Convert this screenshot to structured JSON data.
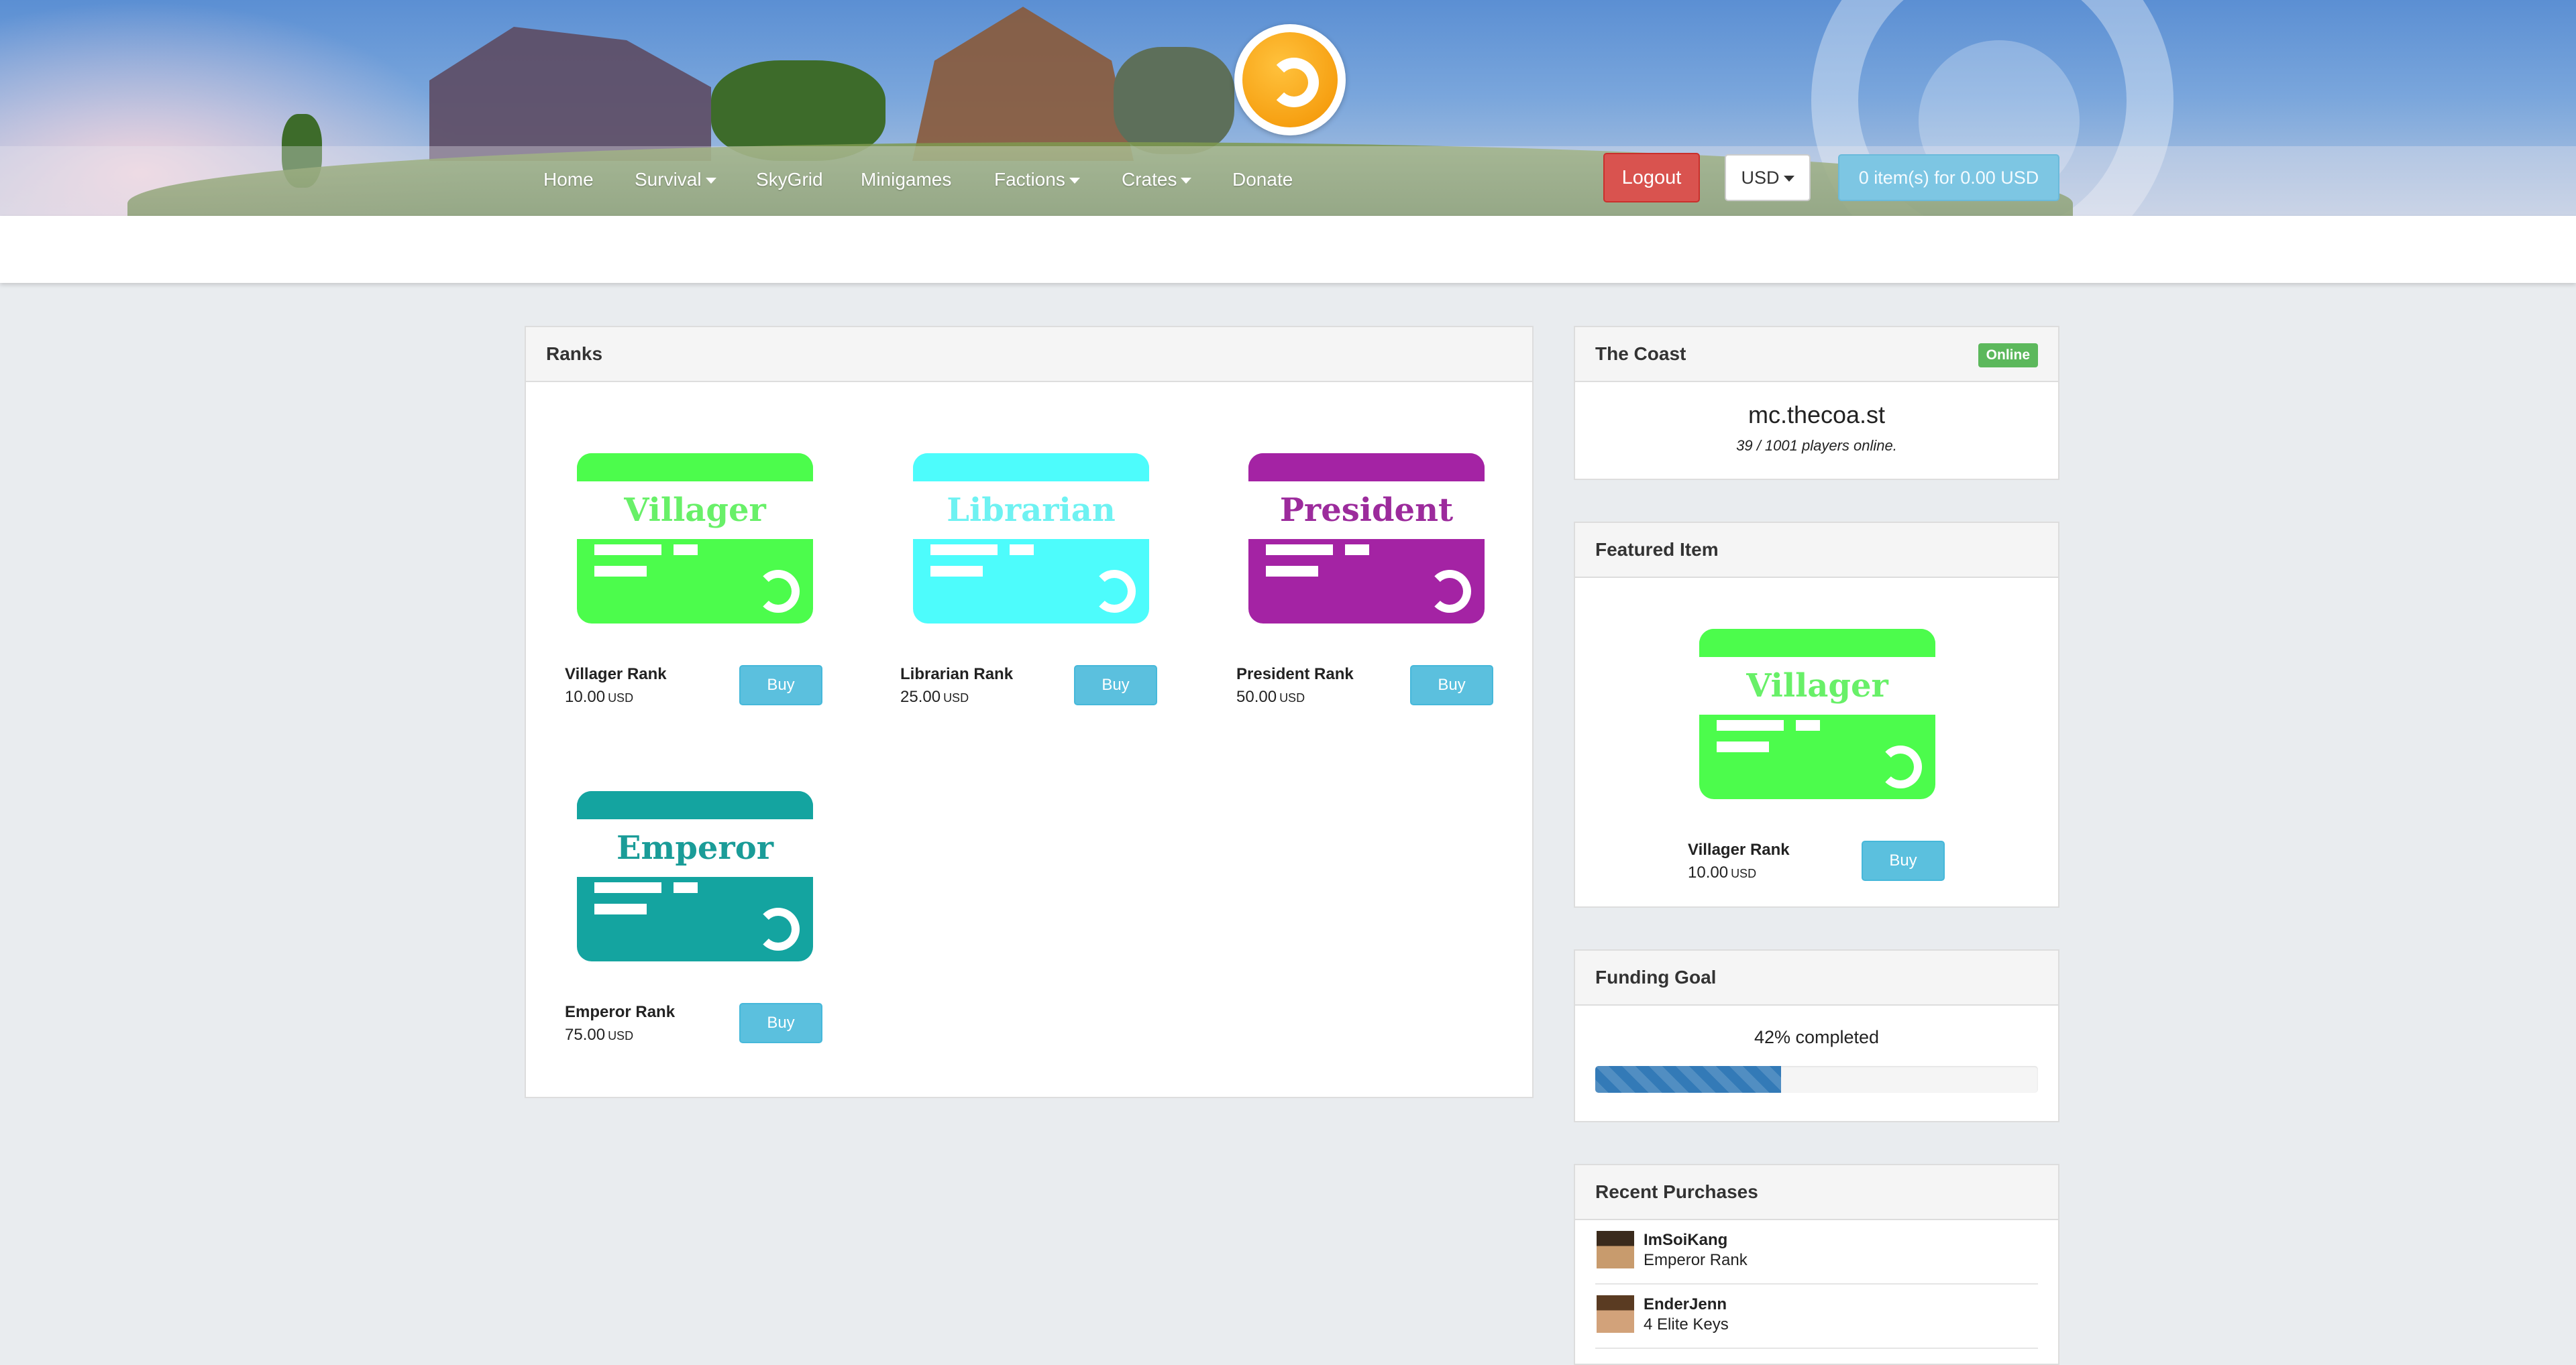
{
  "header": {
    "nav": [
      {
        "label": "Home",
        "dropdown": false
      },
      {
        "label": "Survival",
        "dropdown": true
      },
      {
        "label": "SkyGrid",
        "dropdown": false
      },
      {
        "label": "Minigames",
        "dropdown": false
      },
      {
        "label": "Factions",
        "dropdown": true
      },
      {
        "label": "Crates",
        "dropdown": true
      },
      {
        "label": "Donate",
        "dropdown": false
      }
    ],
    "logout_label": "Logout",
    "currency": "USD",
    "cart_label": "0 item(s) for 0.00 USD"
  },
  "ranks": {
    "title": "Ranks",
    "buy_label": "Buy",
    "products": [
      {
        "card_title": "Villager",
        "name": "Villager Rank",
        "price": "10.00",
        "currency": "USD",
        "color": "#4cfc4c",
        "text_color": "#68f068"
      },
      {
        "card_title": "Librarian",
        "name": "Librarian Rank",
        "price": "25.00",
        "currency": "USD",
        "color": "#4dfcfc",
        "text_color": "#6ef2f2"
      },
      {
        "card_title": "President",
        "name": "President Rank",
        "price": "50.00",
        "currency": "USD",
        "color": "#a423a4",
        "text_color": "#9c2b9c"
      },
      {
        "card_title": "Emperor",
        "name": "Emperor Rank",
        "price": "75.00",
        "currency": "USD",
        "color": "#14a4a0",
        "text_color": "#1a9c98"
      }
    ]
  },
  "server": {
    "title": "The Coast",
    "status": "Online",
    "host": "mc.thecoa.st",
    "players": "39 / 1001 players online."
  },
  "featured": {
    "title": "Featured Item",
    "card_title": "Villager",
    "name": "Villager Rank",
    "price": "10.00",
    "currency": "USD",
    "buy_label": "Buy",
    "color": "#4cfc4c",
    "text_color": "#68f068"
  },
  "funding": {
    "title": "Funding Goal",
    "text": "42% completed",
    "progress": 0.42
  },
  "recent": {
    "title": "Recent Purchases",
    "items": [
      {
        "user": "ImSoiKang",
        "item": "Emperor Rank"
      },
      {
        "user": "EnderJenn",
        "item": "4 Elite Keys"
      }
    ]
  }
}
